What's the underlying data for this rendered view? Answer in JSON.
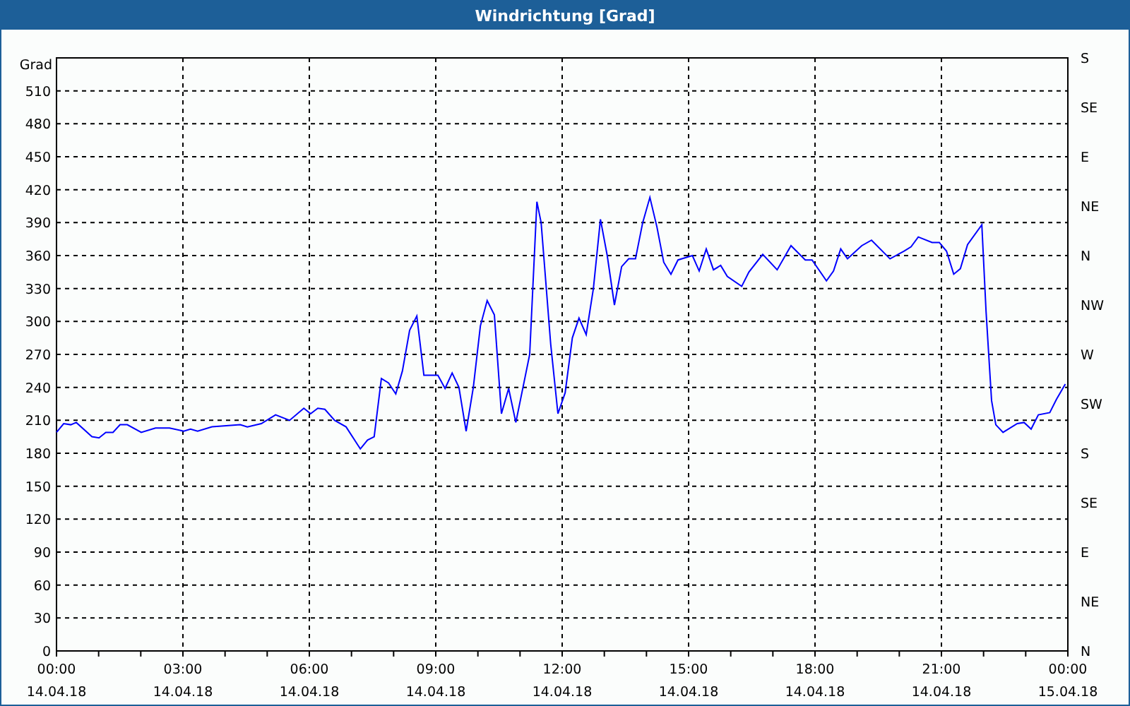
{
  "window": {
    "title": "Windrichtung [Grad]"
  },
  "compass_labels": [
    "S",
    "SE",
    "E",
    "NE",
    "N",
    "NW",
    "W",
    "SW",
    "S",
    "SE",
    "E",
    "NE",
    "N"
  ],
  "x_dates": [
    "14.04.18",
    "14.04.18",
    "14.04.18",
    "14.04.18",
    "14.04.18",
    "14.04.18",
    "14.04.18",
    "14.04.18",
    "15.04.18"
  ],
  "chart_data": {
    "type": "line",
    "grid": true,
    "ylabel": "Grad",
    "xlim": [
      0,
      24
    ],
    "ylim": [
      0,
      540
    ],
    "yticks": [
      0,
      30,
      60,
      90,
      120,
      150,
      180,
      210,
      240,
      270,
      300,
      330,
      360,
      390,
      420,
      450,
      480,
      510
    ],
    "xticks": [
      {
        "value": 0,
        "label": "00:00"
      },
      {
        "value": 3,
        "label": "03:00"
      },
      {
        "value": 6,
        "label": "06:00"
      },
      {
        "value": 9,
        "label": "09:00"
      },
      {
        "value": 12,
        "label": "12:00"
      },
      {
        "value": 15,
        "label": "15:00"
      },
      {
        "value": 18,
        "label": "18:00"
      },
      {
        "value": 21,
        "label": "21:00"
      },
      {
        "value": 24,
        "label": "00:00"
      }
    ],
    "x": [
      0,
      0.17,
      0.34,
      0.47,
      0.84,
      1.01,
      1.17,
      1.34,
      1.51,
      1.68,
      2.01,
      2.35,
      2.68,
      3.02,
      3.18,
      3.35,
      3.69,
      4.36,
      4.53,
      4.86,
      5.2,
      5.53,
      5.87,
      6.03,
      6.2,
      6.37,
      6.6,
      6.87,
      7.21,
      7.38,
      7.54,
      7.71,
      7.88,
      8.05,
      8.21,
      8.38,
      8.55,
      8.72,
      9.05,
      9.22,
      9.39,
      9.55,
      9.72,
      9.89,
      10.06,
      10.22,
      10.39,
      10.56,
      10.73,
      10.9,
      11.23,
      11.4,
      11.5,
      11.73,
      11.9,
      12.07,
      12.24,
      12.4,
      12.57,
      12.74,
      12.91,
      13.07,
      13.24,
      13.41,
      13.58,
      13.74,
      13.91,
      14.08,
      14.25,
      14.41,
      14.58,
      14.75,
      15.09,
      15.25,
      15.42,
      15.59,
      15.76,
      15.92,
      16.26,
      16.43,
      16.76,
      17.1,
      17.43,
      17.77,
      17.93,
      18.27,
      18.44,
      18.61,
      18.77,
      19.11,
      19.34,
      19.78,
      20.11,
      20.28,
      20.45,
      20.78,
      20.95,
      21.12,
      21.29,
      21.45,
      21.62,
      21.96,
      22.06,
      22.19,
      22.29,
      22.46,
      22.8,
      22.96,
      23.13,
      23.3,
      23.57,
      23.73,
      23.94
    ],
    "series": [
      {
        "color": "#0000ff",
        "values": [
          199,
          207,
          206,
          208,
          195,
          194,
          199,
          199,
          206,
          206,
          199,
          203,
          203,
          200,
          202,
          200,
          204,
          206,
          204,
          207,
          215,
          210,
          221,
          216,
          221,
          220,
          210,
          204,
          184,
          192,
          195,
          248,
          244,
          234,
          255,
          292,
          305,
          251,
          251,
          239,
          253,
          240,
          200,
          240,
          296,
          319,
          306,
          216,
          239,
          208,
          270,
          409,
          390,
          279,
          216,
          235,
          285,
          303,
          288,
          330,
          393,
          360,
          315,
          350,
          357,
          357,
          390,
          413,
          386,
          354,
          343,
          356,
          360,
          346,
          366,
          347,
          351,
          341,
          332,
          345,
          361,
          347,
          369,
          356,
          356,
          337,
          346,
          366,
          357,
          369,
          374,
          357,
          364,
          368,
          377,
          372,
          372,
          364,
          343,
          348,
          370,
          388,
          309,
          228,
          206,
          199,
          207,
          208,
          202,
          215,
          217,
          229,
          243
        ]
      }
    ]
  }
}
